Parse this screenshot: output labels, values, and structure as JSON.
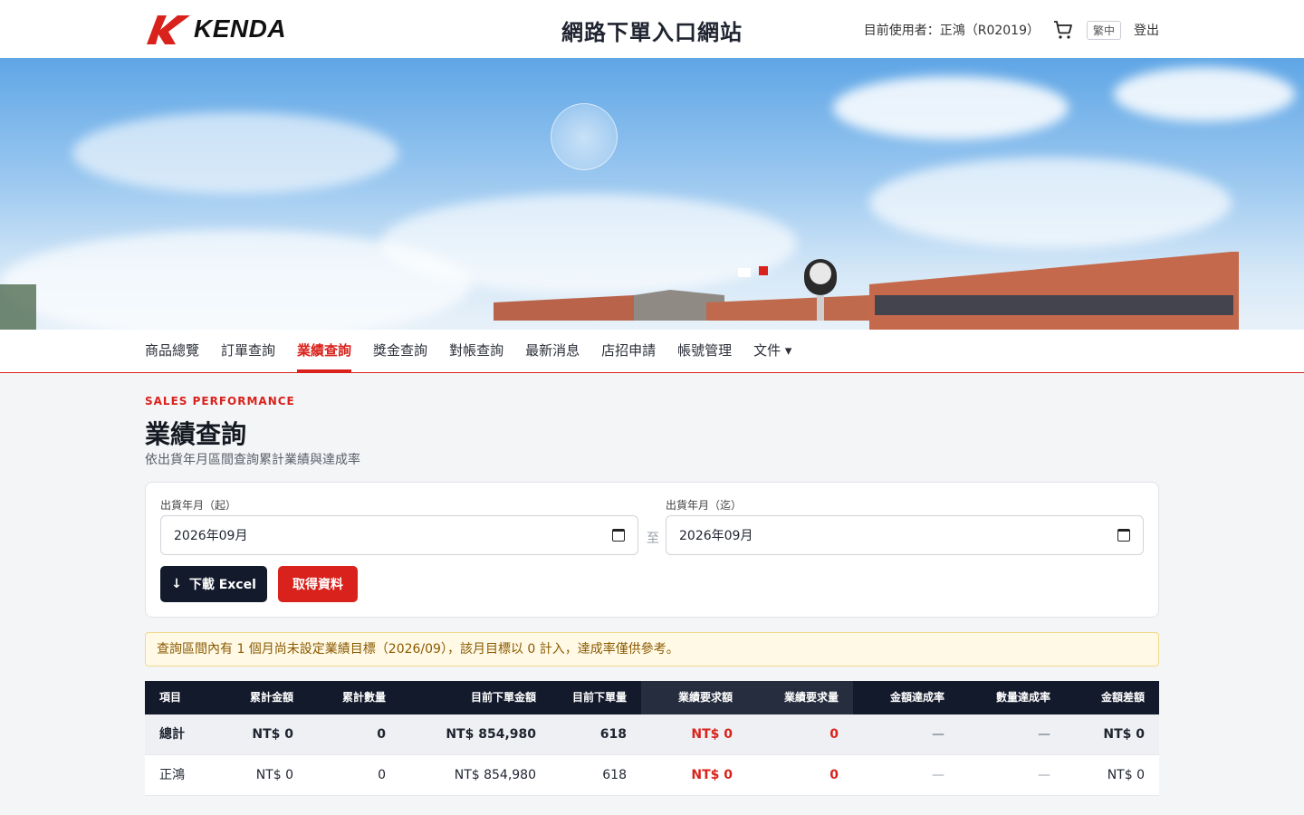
{
  "header": {
    "logo_text": "KENDA",
    "title": "網路下單入口網站",
    "user_label": "目前使用者：正鴻（R02019）",
    "lang": "繁中",
    "logout": "登出"
  },
  "nav": {
    "items": [
      {
        "label": "商品總覽",
        "active": false
      },
      {
        "label": "訂單查詢",
        "active": false
      },
      {
        "label": "業績查詢",
        "active": true
      },
      {
        "label": "獎金查詢",
        "active": false
      },
      {
        "label": "對帳查詢",
        "active": false
      },
      {
        "label": "最新消息",
        "active": false
      },
      {
        "label": "店招申請",
        "active": false
      },
      {
        "label": "帳號管理",
        "active": false
      },
      {
        "label": "文件 ▾",
        "active": false
      }
    ]
  },
  "page": {
    "eyebrow": "SALES PERFORMANCE",
    "title": "業績查詢",
    "subtitle": "依出貨年月區間查詢累計業績與達成率"
  },
  "filter": {
    "start_label": "出貨年月（起）",
    "start_value": "2026年09月",
    "range_sep": "至",
    "end_label": "出貨年月（迄）",
    "end_value": "2026年09月",
    "download_label": "下載 Excel",
    "fetch_label": "取得資料"
  },
  "notice": "查詢區間內有 1 個月尚未設定業績目標（2026/09），該月目標以 0 計入，達成率僅供參考。",
  "table": {
    "headers": [
      "項目",
      "累計金額",
      "累計數量",
      "目前下單金額",
      "目前下單量",
      "業績要求額",
      "業績要求量",
      "金額達成率",
      "數量達成率",
      "金額差額"
    ],
    "rows": [
      [
        "總計",
        "NT$ 0",
        "0",
        "NT$ 854,980",
        "618",
        "NT$ 0",
        "0",
        "—",
        "—",
        "NT$ 0"
      ],
      [
        "正鴻",
        "NT$ 0",
        "0",
        "NT$ 854,980",
        "618",
        "NT$ 0",
        "0",
        "—",
        "—",
        "NT$ 0"
      ]
    ]
  },
  "colors": {
    "brand_red": "#d9221c",
    "dark_navy": "#131a2c"
  }
}
